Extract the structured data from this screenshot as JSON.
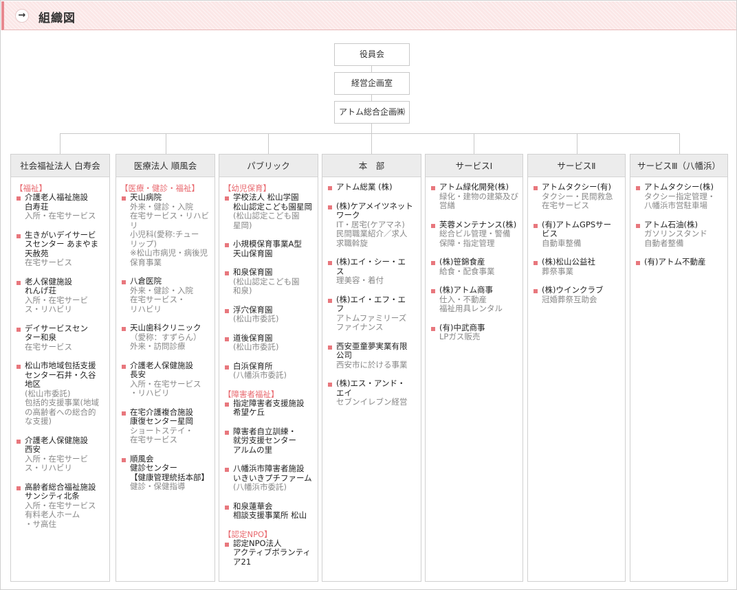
{
  "header": {
    "arrow": "→",
    "title": "組織図"
  },
  "top": [
    "役員会",
    "経営企画室",
    "アトム総合企画㈱"
  ],
  "columns": [
    {
      "title": "社会福祉法人 白寿会",
      "sections": [
        {
          "category": "【福祉】",
          "items": [
            {
              "name": "介護老人福祉施設\n白寿荘",
              "desc": "入所・在宅サービス"
            },
            {
              "name": "生きがいデイサービ\nスセンター あまやま\n天赦苑",
              "desc": "在宅サービス"
            },
            {
              "name": "老人保健施設\nれんげ荘",
              "desc": "入所・在宅サービ\nス・リハビリ"
            },
            {
              "name": "デイサービスセン\nター和泉",
              "desc": "在宅サービス"
            },
            {
              "name": "松山市地域包括支援\nセンター石井・久谷\n地区",
              "desc": "(松山市委託)\n包括的支援事業(地域\nの高齢者への総合的\nな支援)"
            },
            {
              "name": "介護老人保健施設\n西安",
              "desc": "入所・在宅サービ\nス・リハビリ"
            },
            {
              "name": "高齢者総合福祉施設\nサンシティ北条",
              "desc": "入所・在宅サービス\n有料老人ホーム\n・サ高住"
            }
          ]
        }
      ]
    },
    {
      "title": "医療法人 順風会",
      "sections": [
        {
          "category": "【医療・健診・福祉】",
          "items": [
            {
              "name": "天山病院",
              "desc": "外来・健診・入院\n在宅サービス・リハビリ\n小児科(愛称:チュー\nリップ)\n※松山市病児・病後児\n保育事業"
            },
            {
              "name": "八倉医院",
              "desc": "外来・健診・入院\n在宅サービス・\nリハビリ\n "
            },
            {
              "name": "天山歯科クリニック",
              "desc": "（愛称：すずらん）\n外来・訪問診療"
            },
            {
              "name": "介護老人保健施設\n長安",
              "desc": "入所・在宅サービス\n・リハビリ"
            },
            {
              "name": "在宅介護複合施設\n康復センター星岡",
              "desc": "ショートステイ・\n在宅サービス"
            },
            {
              "name": "順風会\n健診センター\n【健康管理統括本部】",
              "desc": "健診・保健指導"
            }
          ]
        }
      ]
    },
    {
      "title": "パブリック",
      "sections": [
        {
          "category": "【幼児保育】",
          "items": [
            {
              "name": "学校法人 松山学園\n松山認定こども園星岡",
              "desc": "(松山認定こども園\n星岡)"
            },
            {
              "name": "小規模保育事業A型\n天山保育園",
              "desc": ""
            },
            {
              "name": "和泉保育園",
              "desc": "(松山認定こども園\n和泉)"
            },
            {
              "name": "浮穴保育園",
              "desc": "(松山市委託)"
            },
            {
              "name": "道後保育園",
              "desc": "(松山市委託)"
            },
            {
              "name": "白浜保育所",
              "desc": "(八幡浜市委託)"
            }
          ]
        },
        {
          "category": "【障害者福祉】",
          "items": [
            {
              "name": "指定障害者支援施設\n希望ケ丘",
              "desc": ""
            },
            {
              "name": "障害者自立訓練・\n就労支援センター\nアルムの里",
              "desc": ""
            },
            {
              "name": "八幡浜市障害者施設\nいきいきプチファーム",
              "desc": "(八幡浜市委託)"
            },
            {
              "name": "和泉蓮華会\n相談支援事業所 松山",
              "desc": ""
            }
          ]
        },
        {
          "category": "【認定NPO】",
          "items": [
            {
              "name": "認定NPO法人\nアクティブボランティ\nア21",
              "desc": ""
            }
          ]
        }
      ]
    },
    {
      "title": "本　部",
      "sections": [
        {
          "category": "",
          "items": [
            {
              "name": "アトム総業 (株)",
              "desc": ""
            },
            {
              "name": "(株)ケアメイツネット\nワーク",
              "desc": "IT・居宅(ケアマネ)\n民間職業紹介／求人\n求職斡旋"
            },
            {
              "name": "(株)エイ・シー・エ\nス",
              "desc": "理美容・着付"
            },
            {
              "name": "(株)エイ・エフ・エ\nフ",
              "desc": "アトムファミリーズ\nファイナンス"
            },
            {
              "name": "西安亜童夢実業有限\n公司",
              "desc": "西安市に於ける事業"
            },
            {
              "name": "(株)エス・アンド・\nエイ",
              "desc": "セブンイレブン経営"
            }
          ]
        }
      ]
    },
    {
      "title": "サービスⅠ",
      "sections": [
        {
          "category": "",
          "items": [
            {
              "name": "アトム緑化開発(株)",
              "desc": "緑化・建物の建築及び\n営繕"
            },
            {
              "name": " 芙蓉メンテナンス(株)",
              "desc": "総合ビル管理・警備\n保障・指定管理"
            },
            {
              "name": "(株)笹錦食産",
              "desc": "給食・配食事業"
            },
            {
              "name": "(株)アトム商事",
              "desc": "仕入・不動産\n福祉用具レンタル"
            },
            {
              "name": "(有)中武商事",
              "desc": "LPガス販売"
            }
          ]
        }
      ]
    },
    {
      "title": "サービスⅡ",
      "sections": [
        {
          "category": "",
          "items": [
            {
              "name": "アトムタクシー(有)",
              "desc": "タクシー・民間救急\n在宅サービス"
            },
            {
              "name": "(有)アトムGPSサー\nビス",
              "desc": "自動車整備"
            },
            {
              "name": "(株)松山公益社",
              "desc": "葬祭事業"
            },
            {
              "name": "(株)ウインクラブ",
              "desc": "冠婚葬祭互助会"
            }
          ]
        }
      ]
    },
    {
      "title": "サービスⅢ（八幡浜）",
      "sections": [
        {
          "category": "",
          "items": [
            {
              "name": "アトムタクシー(株)",
              "desc": "タクシー指定管理・\n八幡浜市営駐車場"
            },
            {
              "name": "アトム石油(株)",
              "desc": "ガソリンスタンド\n自動者整備\n "
            },
            {
              "name": "(有)アトム不動産",
              "desc": ""
            }
          ]
        }
      ]
    }
  ]
}
